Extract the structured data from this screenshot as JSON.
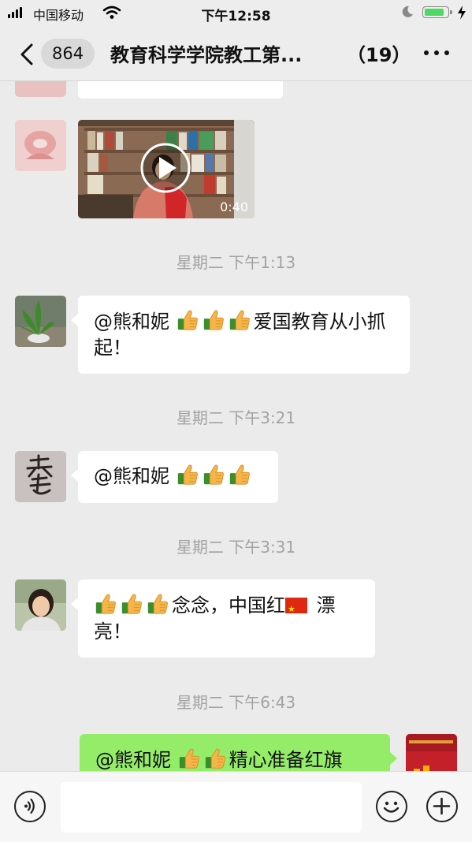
{
  "status_bar": {
    "carrier": "中国移动",
    "time": "下午12:58",
    "battery_level": 0.9
  },
  "nav": {
    "unread_count": "864",
    "title": "教育科学学院教工第...",
    "member_count": "（19）"
  },
  "messages": [
    {
      "type": "video",
      "duration": "0:40"
    },
    {
      "timestamp": "星期二 下午1:13",
      "text_prefix": "@熊和妮 ",
      "emoji_count": 3,
      "text_suffix": "爱国教育从小抓起！"
    },
    {
      "timestamp": "星期二 下午3:21",
      "text_prefix": "@熊和妮 ",
      "emoji_count": 3,
      "text_suffix": ""
    },
    {
      "timestamp": "星期二 下午3:31",
      "emoji_count": 3,
      "text_middle": "念念，中国红",
      "text_suffix": " 漂亮！"
    },
    {
      "timestamp": "星期二 下午6:43",
      "side": "right",
      "text_prefix": "@熊和妮 ",
      "emoji_count": 2,
      "text_suffix": "精心准备红旗"
    }
  ],
  "colors": {
    "background": "#ebebeb",
    "bubble_left": "#ffffff",
    "bubble_right": "#95ec69",
    "timestamp": "#a3a3a3"
  },
  "icons": [
    "back-chevron-icon",
    "more-dots-icon",
    "voice-icon",
    "emoji-icon",
    "plus-icon",
    "thumbs-up-icon",
    "china-flag-icon",
    "play-icon"
  ]
}
